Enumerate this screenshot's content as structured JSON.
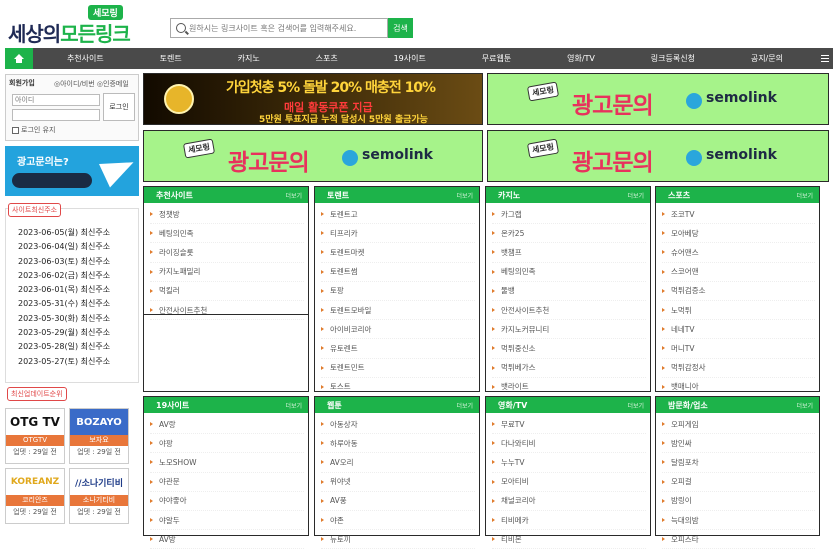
{
  "header": {
    "logo_badge": "세모링",
    "logo_text_a": "세상의",
    "logo_text_b": "모든링크",
    "search_placeholder": "원하시는 링크사이트 혹은 검색어를 입력해주세요.",
    "search_button": "검색"
  },
  "nav": {
    "items": [
      "추천사이트",
      "토렌트",
      "카지노",
      "스포츠",
      "19사이트",
      "무료웹툰",
      "영화/TV",
      "링크등록신청",
      "공지/문의"
    ]
  },
  "login": {
    "title": "회원가입",
    "links": "◎아이디/비번 ◎인증메일",
    "id_placeholder": "아이디",
    "pw_placeholder": "",
    "button": "로그인",
    "keep": "로그인 유지"
  },
  "telegram_banner": {
    "text": "광고문의는?"
  },
  "recent": {
    "title": "사이트최신주소",
    "items": [
      "2023-06-05(월) 최신주소",
      "2023-06-04(일) 최신주소",
      "2023-06-03(토) 최신주소",
      "2023-06-02(금) 최신주소",
      "2023-06-01(목) 최신주소",
      "2023-05-31(수) 최신주소",
      "2023-05-30(화) 최신주소",
      "2023-05-29(월) 최신주소",
      "2023-05-28(일) 최신주소",
      "2023-05-27(토) 최신주소"
    ]
  },
  "updated": {
    "title": "최신업데이트순위",
    "items": [
      {
        "img": "OTG TV",
        "name": "OTGTV",
        "up": "업뎃 : 29일 전"
      },
      {
        "img": "BOZAYO",
        "name": "보자요",
        "up": "업뎃 : 29일 전"
      },
      {
        "img": "KOREANZ",
        "name": "코리안즈",
        "up": "업뎃 : 29일 전"
      },
      {
        "img": "//소나기티비",
        "name": "소나기티비",
        "up": "업뎃 : 29일 전"
      }
    ]
  },
  "casino_banner": {
    "line1": "가입첫충 5% 돌발 20% 매충전 10%",
    "line2": "매일 활동쿠폰 지급",
    "line3": "5만원 투표지급 누적 달성시 5만원 출금가능"
  },
  "ad_banner": {
    "badge": "세모링",
    "text": "광고문의",
    "brand": "semolink"
  },
  "more_label": "더보기",
  "boards": [
    {
      "title": "추천사이트",
      "items": [
        "정챗방",
        "베팅의민족",
        "라이징슬롯",
        "카지노패밀리",
        "먹킬러",
        "안전사이트추천"
      ]
    },
    {
      "title": "토렌트",
      "items": [
        "토렌트고",
        "티프리카",
        "토렌트마켓",
        "토렌트썸",
        "토팡",
        "토렌트모바일",
        "아이비코리아",
        "유토렌트",
        "토렌트민트",
        "토스트"
      ]
    },
    {
      "title": "카지노",
      "items": [
        "카그랩",
        "온카25",
        "뱃챔프",
        "베팅의민족",
        "뚤뱅",
        "안전사이트추천",
        "카지노커뮤니티",
        "먹튀중신소",
        "먹튀베가스",
        "뱃라이트"
      ]
    },
    {
      "title": "스포츠",
      "items": [
        "조코TV",
        "모아베당",
        "슈어맨스",
        "스코어맨",
        "먹튀검증소",
        "노먹튀",
        "네네TV",
        "머니TV",
        "먹튀감정사",
        "뱃매니아"
      ]
    },
    {
      "title": "19사이트",
      "items": [
        "AV랑",
        "야팡",
        "노모SHOW",
        "야관문",
        "야야좋아",
        "야알두",
        "AV방"
      ]
    },
    {
      "title": "웹툰",
      "items": [
        "아동상자",
        "하루아동",
        "AV오리",
        "위야넷",
        "AV풍",
        "야존",
        "뉴토끼"
      ]
    },
    {
      "title": "영화/TV",
      "items": [
        "무료TV",
        "다나와티비",
        "누누TV",
        "모아티비",
        "채널코리아",
        "티비메카",
        "티비몬"
      ]
    },
    {
      "title": "밤문화/업소",
      "items": [
        "오피게임",
        "밤인싸",
        "달림포차",
        "오피걸",
        "밤링이",
        "늑대의밤",
        "오피스타"
      ]
    }
  ]
}
